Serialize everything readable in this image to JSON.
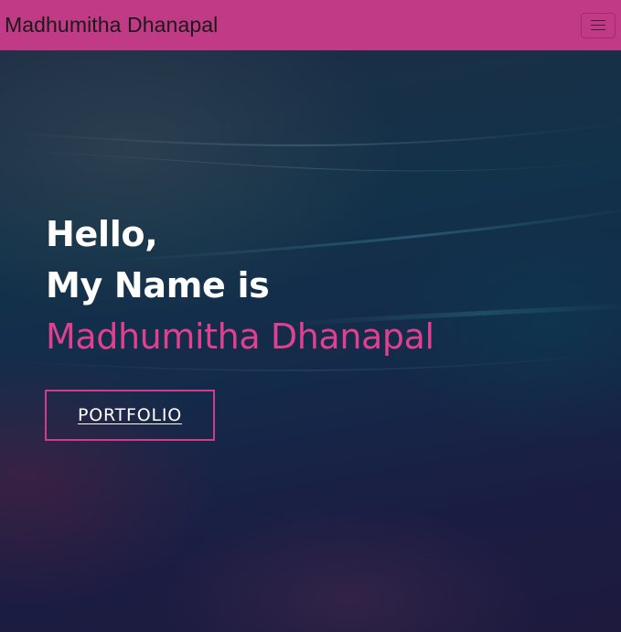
{
  "navbar": {
    "brand": "Madhumitha Dhanapal",
    "toggle_icon": "hamburger-menu-icon"
  },
  "hero": {
    "greeting": "Hello,",
    "intro": "My Name is",
    "name": "Madhumitha Dhanapal",
    "cta_label": "PORTFOLIO"
  },
  "colors": {
    "navbar_bg": "#c03a86",
    "accent": "#e0408f",
    "button_border": "#cf3d8a",
    "hero_text": "#ffffff"
  }
}
